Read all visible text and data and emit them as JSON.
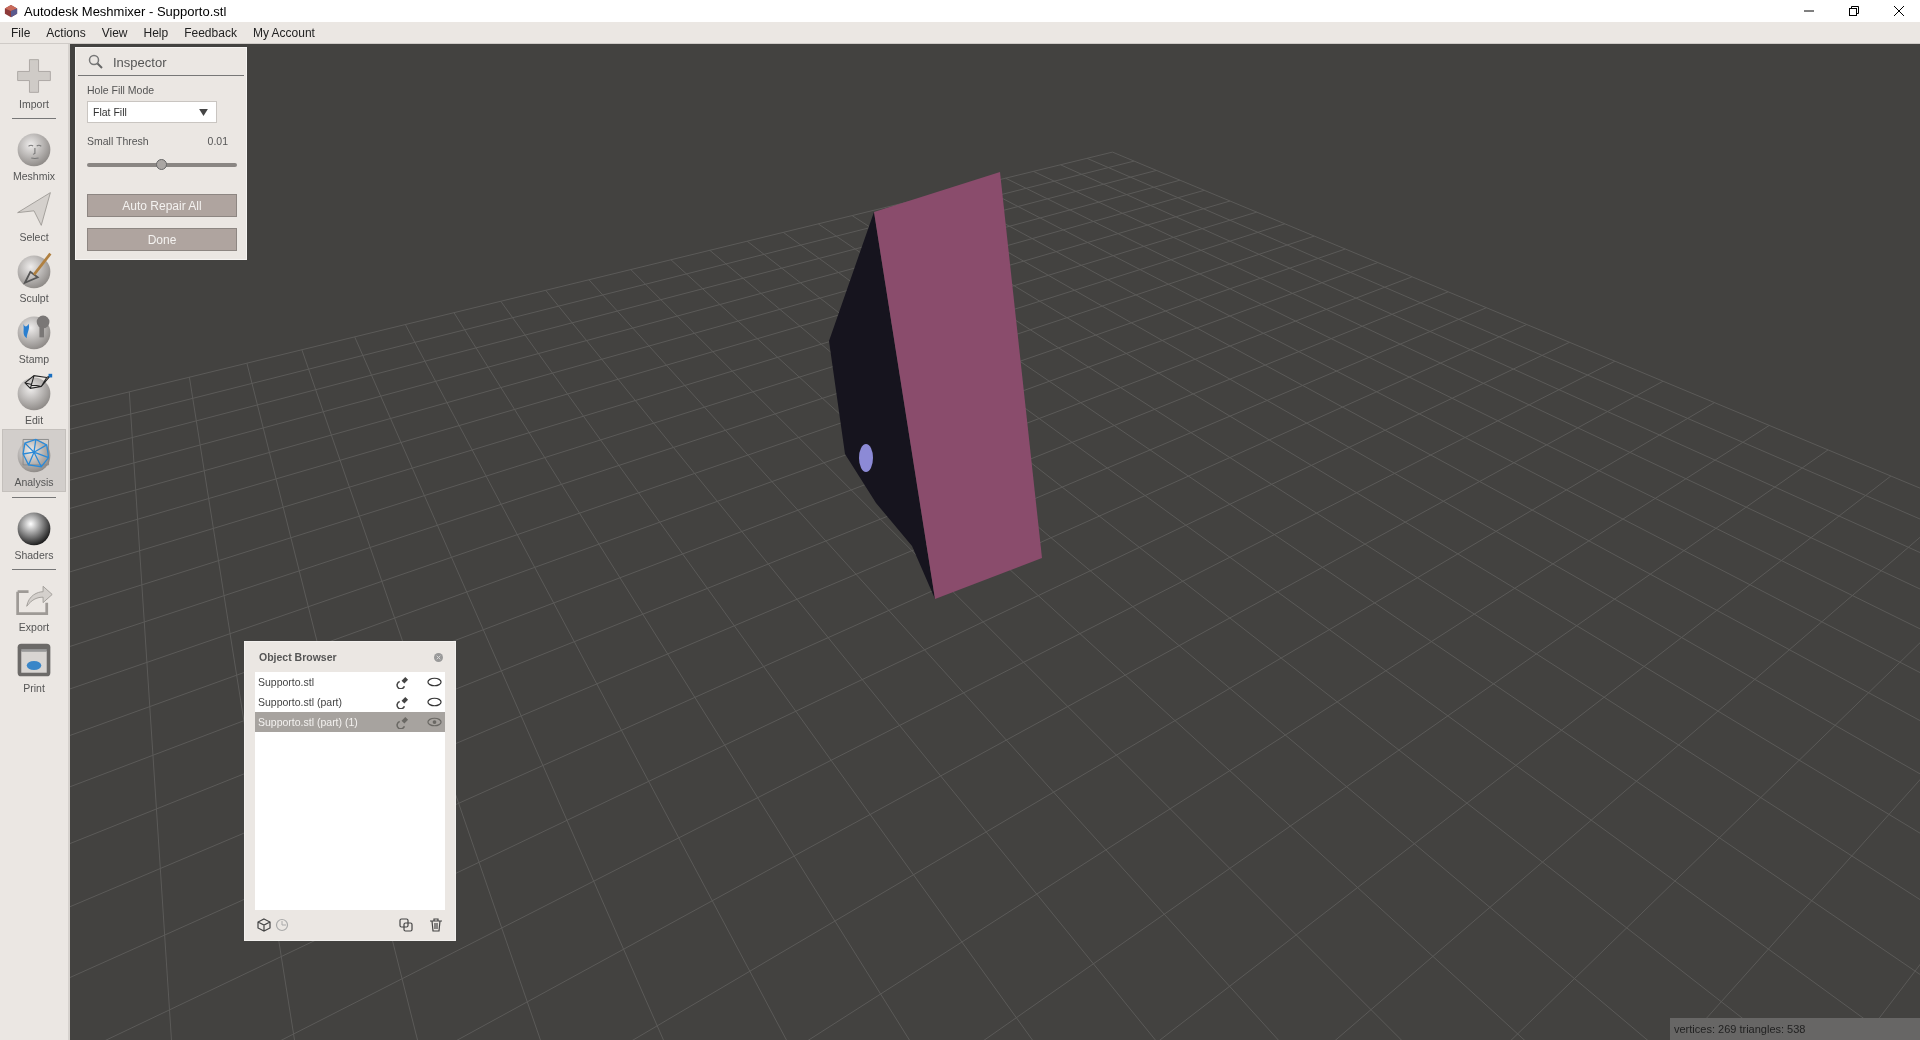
{
  "window": {
    "title": "Autodesk Meshmixer - Supporto.stl"
  },
  "menu": [
    "File",
    "Actions",
    "View",
    "Help",
    "Feedback",
    "My Account"
  ],
  "toolbar": {
    "groups": [
      [
        {
          "label": "Import",
          "selected": false
        }
      ],
      [
        {
          "label": "Meshmix",
          "selected": false
        },
        {
          "label": "Select",
          "selected": false
        },
        {
          "label": "Sculpt",
          "selected": false
        },
        {
          "label": "Stamp",
          "selected": false
        },
        {
          "label": "Edit",
          "selected": false
        },
        {
          "label": "Analysis",
          "selected": true
        }
      ],
      [
        {
          "label": "Shaders",
          "selected": false
        }
      ],
      [
        {
          "label": "Export",
          "selected": false
        },
        {
          "label": "Print",
          "selected": false
        }
      ]
    ]
  },
  "inspector": {
    "title": "Inspector",
    "hole_fill_mode": {
      "label": "Hole Fill Mode",
      "value": "Flat Fill"
    },
    "small_thresh": {
      "label": "Small Thresh",
      "reading": "0.01",
      "level": 0.5
    },
    "buttons": [
      "Auto Repair All",
      "Done"
    ]
  },
  "object_browser": {
    "title": "Object Browser",
    "items": [
      {
        "name": "Supporto.stl",
        "selected": false
      },
      {
        "name": "Supporto.stl (part)",
        "selected": false
      },
      {
        "name": "Supporto.stl (part) (1)",
        "selected": true
      }
    ]
  },
  "status_bar": "vertices: 269 triangles: 538"
}
